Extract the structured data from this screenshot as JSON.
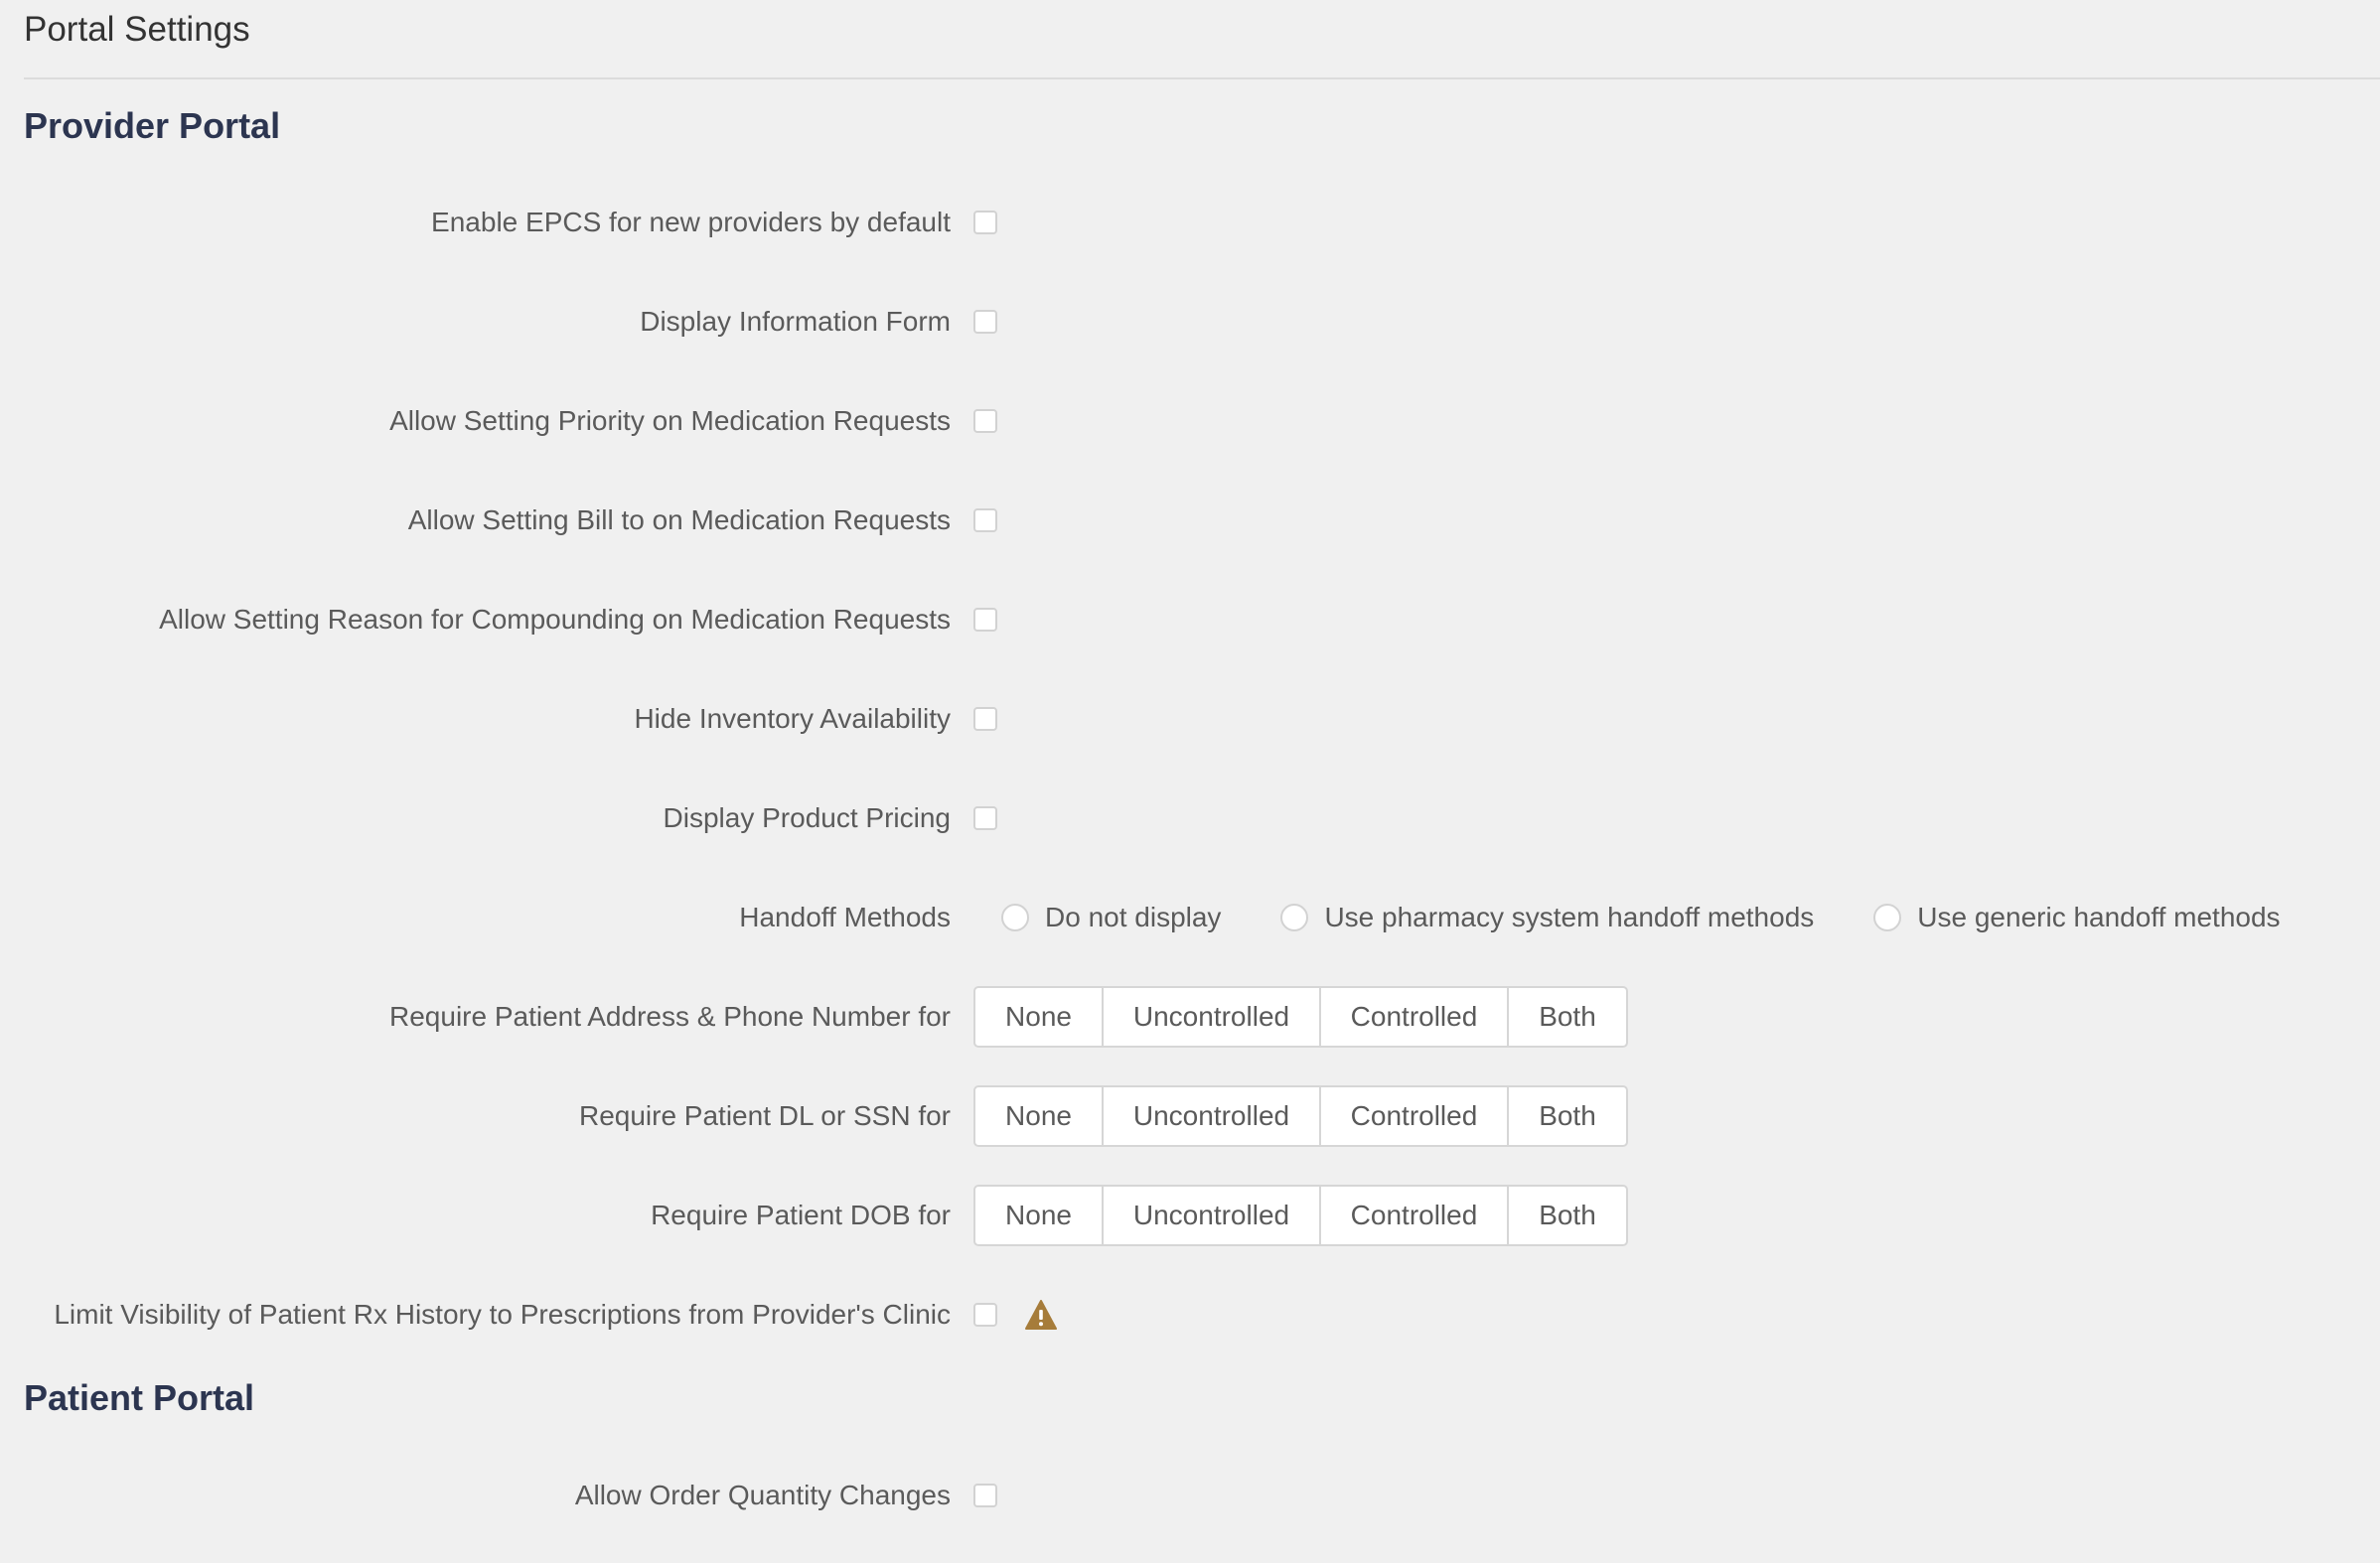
{
  "page": {
    "title": "Portal Settings"
  },
  "provider_portal": {
    "heading": "Provider Portal",
    "settings": {
      "enable_epcs": {
        "label": "Enable EPCS for new providers by default",
        "checked": false
      },
      "display_info_form": {
        "label": "Display Information Form",
        "checked": false
      },
      "allow_priority": {
        "label": "Allow Setting Priority on Medication Requests",
        "checked": false
      },
      "allow_bill_to": {
        "label": "Allow Setting Bill to on Medication Requests",
        "checked": false
      },
      "allow_reason_compounding": {
        "label": "Allow Setting Reason for Compounding on Medication Requests",
        "checked": false
      },
      "hide_inventory": {
        "label": "Hide Inventory Availability",
        "checked": false
      },
      "display_pricing": {
        "label": "Display Product Pricing",
        "checked": false
      }
    },
    "handoff": {
      "label": "Handoff Methods",
      "options": [
        "Do not display",
        "Use pharmacy system handoff methods",
        "Use generic handoff methods"
      ],
      "selected": null
    },
    "require_address": {
      "label": "Require Patient Address & Phone Number for",
      "options": [
        "None",
        "Uncontrolled",
        "Controlled",
        "Both"
      ]
    },
    "require_dl_ssn": {
      "label": "Require Patient DL or SSN for",
      "options": [
        "None",
        "Uncontrolled",
        "Controlled",
        "Both"
      ]
    },
    "require_dob": {
      "label": "Require Patient DOB for",
      "options": [
        "None",
        "Uncontrolled",
        "Controlled",
        "Both"
      ]
    },
    "limit_visibility": {
      "label": "Limit Visibility of Patient Rx History to Prescriptions from Provider's Clinic",
      "checked": false,
      "icon": "warning-icon"
    }
  },
  "patient_portal": {
    "heading": "Patient Portal",
    "settings": {
      "allow_qty_changes": {
        "label": "Allow Order Quantity Changes",
        "checked": false
      }
    }
  },
  "colors": {
    "background": "#f0f0f0",
    "heading": "#2c3550",
    "warning": "#a67c3a"
  }
}
